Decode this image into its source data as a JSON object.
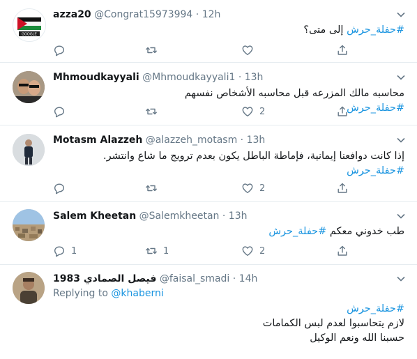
{
  "tweets": [
    {
      "name": "azza20",
      "handle": "@Congrat15973994",
      "time": "12h",
      "hashtag": "#حفلة_حرش",
      "text": "إلى متى؟",
      "replies": "",
      "retweets": "",
      "likes": ""
    },
    {
      "name": "Mhmoudkayyali",
      "handle": "@Mhmoudkayyali1",
      "time": "13h",
      "text": "محاسبه مالك المزرعه قبل محاسبه الأشخاص نفسهم",
      "hashtag": "#حفلة_حرش",
      "replies": "",
      "retweets": "",
      "likes": "2"
    },
    {
      "name": "Motasm Alazzeh",
      "handle": "@alazzeh_motasm",
      "time": "13h",
      "text": "إذا كانت دوافعنا إيمانية، فإماطة الباطل يكون بعدم ترويج ما شاع وانتشر.",
      "hashtag": "#حفلة_حرش",
      "replies": "",
      "retweets": "",
      "likes": "2"
    },
    {
      "name": "Salem Kheetan",
      "handle": "@Salemkheetan",
      "time": "13h",
      "text": "طب خدوني معكم",
      "hashtag": "#حفلة_حرش",
      "replies": "1",
      "retweets": "1",
      "likes": "2"
    },
    {
      "name": "فيصل الصمادي 1983",
      "handle": "@faisal_smadi",
      "time": "14h",
      "replying_label": "Replying to",
      "replying_to": "@khaberni",
      "hashtag": "#حفلة_حرش",
      "line1": "لازم يتحاسبوا لعدم لبس الكمامات",
      "line2": "حسبنا الله ونعم الوكيل"
    }
  ],
  "separator": "·",
  "icons": [
    "reply-icon",
    "retweet-icon",
    "like-icon",
    "share-icon",
    "caret-down-icon"
  ],
  "colors": {
    "link": "#1b95e0",
    "muted": "#657786",
    "border": "#e6ecf0"
  }
}
